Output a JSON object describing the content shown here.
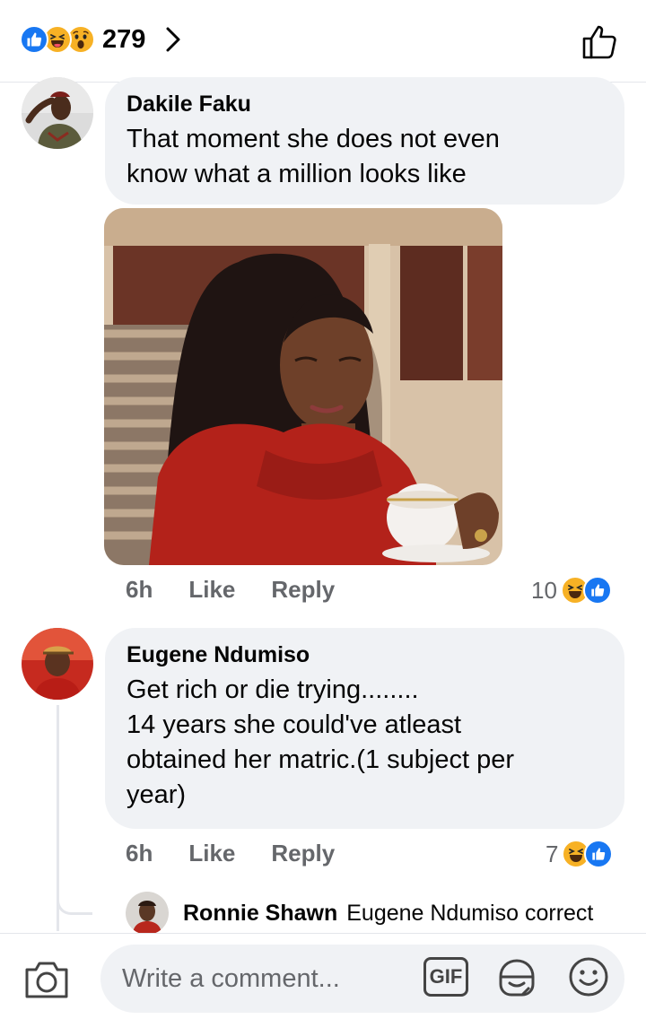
{
  "header": {
    "reaction_count": "279",
    "reactions": [
      "like-icon",
      "haha-icon",
      "wow-icon"
    ]
  },
  "comments": [
    {
      "author": "Dakile Faku",
      "text_lines": [
        "That moment she does not even",
        "know what a million looks like"
      ],
      "time": "6h",
      "like_label": "Like",
      "reply_label": "Reply",
      "reaction_count": "10",
      "reactions": [
        "haha-icon",
        "like-icon"
      ],
      "has_photo": true
    },
    {
      "author": "Eugene Ndumiso",
      "text_lines": [
        "Get rich or die trying........",
        "14 years she could've atleast",
        "obtained her matric.(1 subject per",
        "year)"
      ],
      "time": "6h",
      "like_label": "Like",
      "reply_label": "Reply",
      "reaction_count": "7",
      "reactions": [
        "haha-icon",
        "like-icon"
      ]
    }
  ],
  "reply_preview": {
    "author": "Ronnie Shawn",
    "text": "Eugene Ndumiso correct"
  },
  "composer": {
    "placeholder": "Write a comment...",
    "gif_label": "GIF"
  },
  "colors": {
    "like_blue": "#1877f2",
    "haha_yellow": "#f7b125",
    "bubble_bg": "#f0f2f5",
    "meta_gray": "#65676b"
  }
}
